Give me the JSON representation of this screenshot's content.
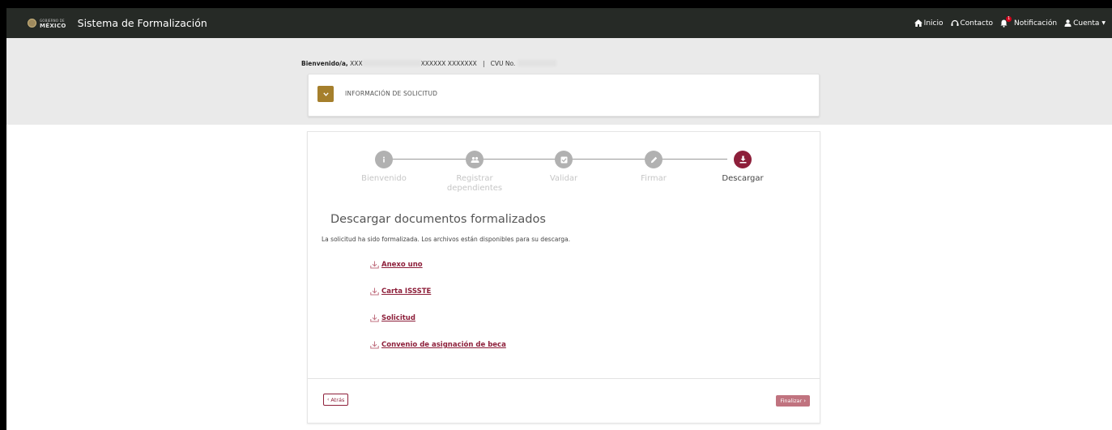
{
  "topbar": {
    "logo_line1": "GOBIERNO DE",
    "logo_line2": "MÉXICO",
    "app_title": "Sistema de Formalización",
    "nav": {
      "home": "Inicio",
      "contact": "Contacto",
      "notifications": "Notificación",
      "notification_count": "1",
      "account": "Cuenta"
    }
  },
  "welcome": {
    "label": "Bienvenido/a,",
    "name_visible": "XXXXXX XXXXXXX",
    "name_prefix": "XXX",
    "separator": "|",
    "cvu_label": "CVU No."
  },
  "info_panel": {
    "title": "INFORMACIÓN DE SOLICITUD"
  },
  "steps": [
    {
      "label": "Bienvenido",
      "icon": "info-icon",
      "active": false
    },
    {
      "label": "Registrar dependientes",
      "icon": "users-icon",
      "active": false
    },
    {
      "label": "Validar",
      "icon": "check-square-icon",
      "active": false
    },
    {
      "label": "Firmar",
      "icon": "pencil-icon",
      "active": false
    },
    {
      "label": "Descargar",
      "icon": "download-icon",
      "active": true
    }
  ],
  "content": {
    "title": "Descargar documentos formalizados",
    "description": "La solicitud ha sido formalizada. Los archivos están disponibles para su descarga.",
    "documents": [
      {
        "label": "Anexo uno"
      },
      {
        "label": "Carta ISSSTE"
      },
      {
        "label": "Solicitud"
      },
      {
        "label": "Convenio de asignación de beca"
      }
    ]
  },
  "footer": {
    "back_label": "Atrás",
    "finish_label": "Finalizar"
  },
  "colors": {
    "topbar_bg": "#262a26",
    "accent": "#8d1f3a",
    "gold": "#a57f2c",
    "step_inactive": "#b1b1b1"
  }
}
